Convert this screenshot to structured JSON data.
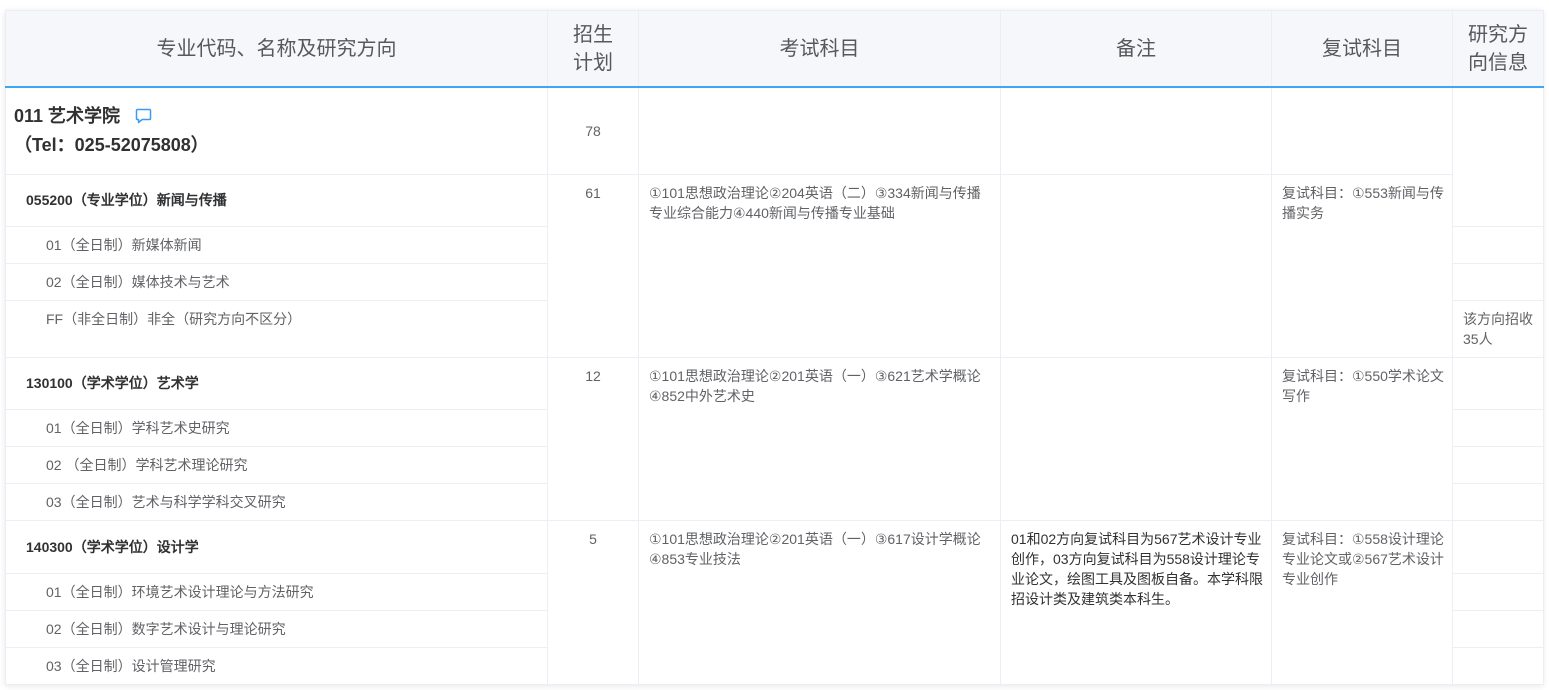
{
  "headers": {
    "major": "专业代码、名称及研究方向",
    "plan": "招生计划",
    "exam": "考试科目",
    "remarks": "备注",
    "retest": "复试科目",
    "direction_info": "研究方向信息"
  },
  "college": {
    "name": "011 艺术学院",
    "tel": "（Tel：025-52075808）",
    "plan": "78",
    "contact_icon": "message-icon"
  },
  "majors": [
    {
      "name": "055200（专业学位）新闻与传播",
      "plan": "61",
      "exam": "①101思想政治理论②204英语（二）③334新闻与传播专业综合能力④440新闻与传播专业基础",
      "retest": "复试科目：①553新闻与传播实务",
      "directions": [
        {
          "name": "01（全日制）新媒体新闻"
        },
        {
          "name": "02（全日制）媒体技术与艺术"
        },
        {
          "name": "FF（非全日制）非全（研究方向不区分）",
          "info": "该方向招收35人"
        }
      ]
    },
    {
      "name": "130100（学术学位）艺术学",
      "plan": "12",
      "exam": "①101思想政治理论②201英语（一）③621艺术学概论④852中外艺术史",
      "retest": "复试科目：①550学术论文写作",
      "directions": [
        {
          "name": "01（全日制）学科艺术史研究"
        },
        {
          "name": "02 （全日制）学科艺术理论研究"
        },
        {
          "name": "03（全日制）艺术与科学学科交叉研究"
        }
      ]
    },
    {
      "name": "140300（学术学位）设计学",
      "plan": "5",
      "exam": "①101思想政治理论②201英语（一）③617设计学概论④853专业技法",
      "remarks": "01和02方向复试科目为567艺术设计专业创作，03方向复试科目为558设计理论专业论文，绘图工具及图板自备。本学科限招设计类及建筑类本科生。",
      "retest": "复试科目：①558设计理论专业论文或②567艺术设计专业创作",
      "directions": [
        {
          "name": "01（全日制）环境艺术设计理论与方法研究"
        },
        {
          "name": "02（全日制）数字艺术设计与理论研究"
        },
        {
          "name": "03（全日制）设计管理研究"
        }
      ]
    }
  ],
  "colors": {
    "header_background": "#f5f7fa",
    "header_underline": "#3ea6f2",
    "icon": "#3a9cf0",
    "grid_line": "#ebeef5",
    "text": "#606266",
    "strong_text": "#303133"
  }
}
